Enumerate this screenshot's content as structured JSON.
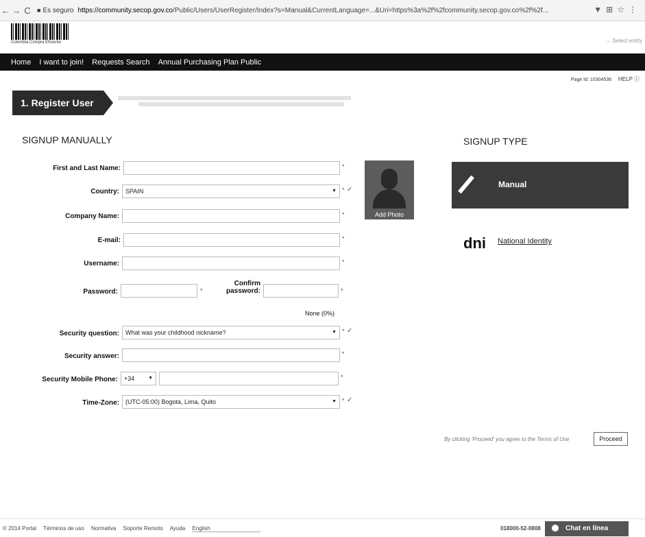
{
  "browser": {
    "back": "←",
    "forward": "→",
    "reload": "C",
    "secure": "Es seguro",
    "url_host": "https://community.secop.gov.co",
    "url_path": "/Public/Users/UserRegister/Index?s=Manual&CurrentLanguage=...&Uri=https%3a%2f%2fcommunity.secop.gov.co%2f%2f..."
  },
  "header": {
    "logo_caption": "Colombia Compra Eficiente",
    "top_right": "→ Select entity"
  },
  "nav": {
    "items": [
      "Home",
      "I want to join!",
      "Requests Search",
      "Annual Purchasing Plan Public"
    ]
  },
  "page": {
    "page_id": "Page Id: 10304536",
    "help": "HELP ⓘ",
    "step_title": "1. Register User",
    "left_title": "SIGNUP MANUALLY",
    "right_title": "SIGNUP TYPE"
  },
  "form": {
    "first_last_name_label": "First and Last Name:",
    "first_last_name_value": "",
    "country_label": "Country:",
    "country_value": "SPAIN",
    "company_label": "Company Name:",
    "company_value": "",
    "email_label": "E-mail:",
    "email_value": "",
    "username_label": "Username:",
    "username_value": "",
    "password_label": "Password:",
    "confirm_label": "Confirm password:",
    "strength": "None (0%)",
    "security_question_label": "Security question:",
    "security_question_value": "What was your childhood nickname?",
    "security_answer_label": "Security answer:",
    "mobile_label": "Security Mobile Phone:",
    "mobile_prefix": "+34",
    "timezone_label": "Time-Zone:",
    "timezone_value": "(UTC-05:00) Bogota, Lima, Quito",
    "required_mark": "*",
    "check_mark": "✓",
    "add_photo": "Add Photo"
  },
  "signup_type": {
    "manual": "Manual",
    "dni_logo": "dni",
    "national_identity": "National Identity"
  },
  "actions": {
    "terms_text": "By clicking 'Proceed' you agree to the Terms of Use",
    "proceed": "Proceed"
  },
  "footer": {
    "copyright": "© 2014 Portal",
    "terms": "Términos de uso",
    "normative": "Normativa",
    "support": "Soporte Remoto",
    "help": "Ayuda",
    "language": "English",
    "phone": "018000-52-0808",
    "chat": "Chat en línea"
  }
}
